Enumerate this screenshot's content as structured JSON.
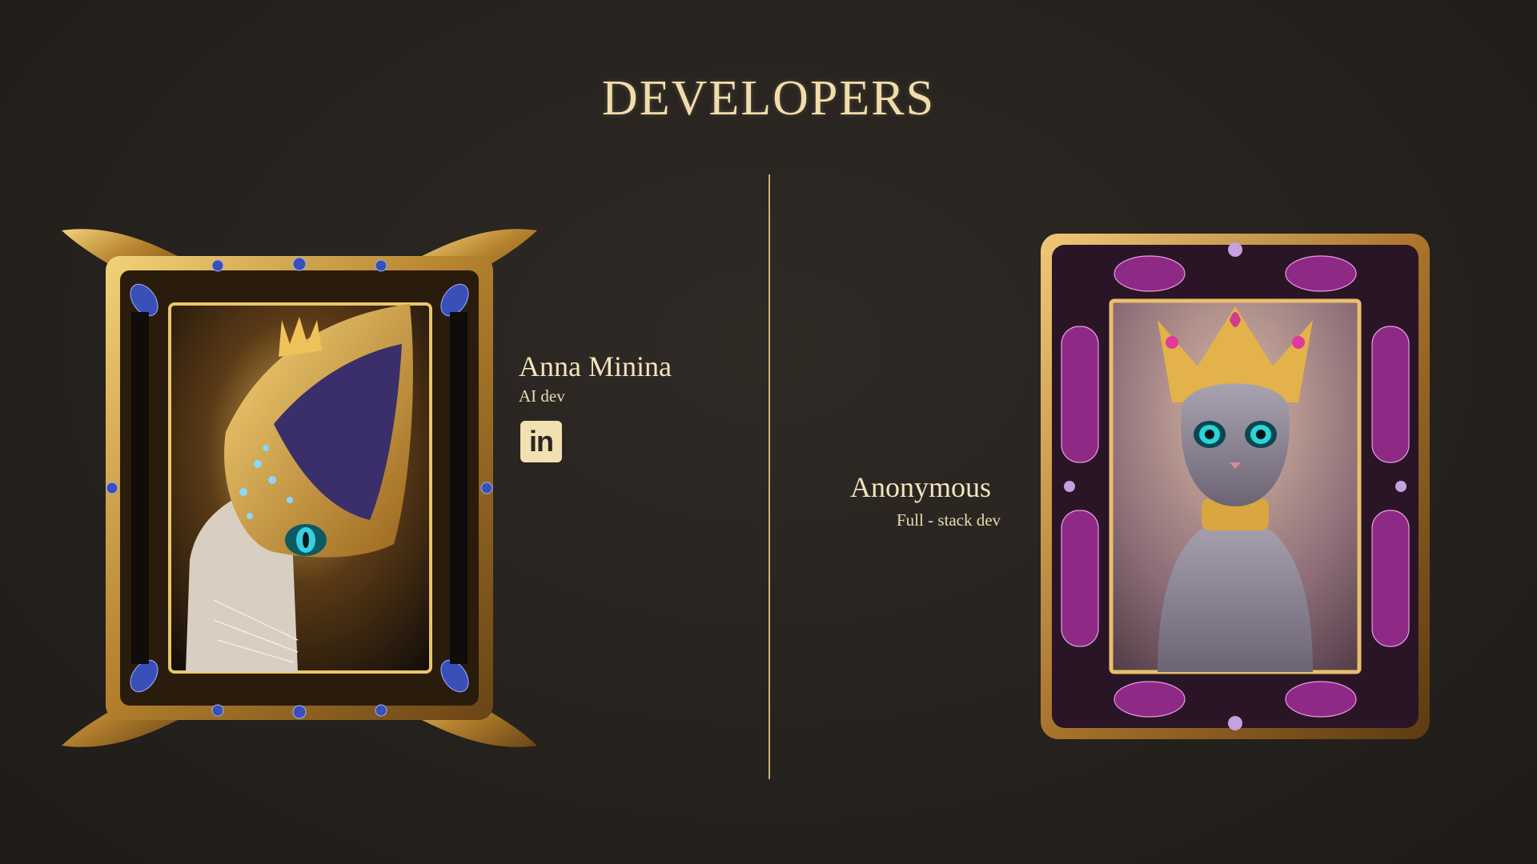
{
  "page": {
    "title": "DEVELOPERS"
  },
  "developers": [
    {
      "name": "Anna Minina",
      "role": "AI dev",
      "social": {
        "icon": "linkedin-icon",
        "label": "in"
      },
      "portrait": "cat-with-golden-jeweled-mask-portrait",
      "frame_style": "gold-blue-gem-ornate-frame"
    },
    {
      "name": "Anonymous",
      "role": "Full - stack dev",
      "portrait": "grey-cat-with-golden-crown-portrait",
      "frame_style": "gold-purple-gem-ornate-frame"
    }
  ],
  "colors": {
    "background": "#282420",
    "text_gold": "#f0ddac",
    "divider": "#c9b07a",
    "frame_gold": "#c79a3e",
    "gem_blue": "#3b4fb8",
    "gem_purple": "#8e2a86"
  }
}
